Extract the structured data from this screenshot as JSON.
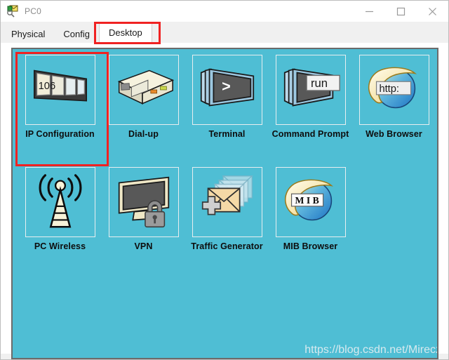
{
  "window": {
    "title": "PC0",
    "title_icon": "packet-tracer-device-icon",
    "buttons": {
      "minimize": "minimize-icon",
      "maximize": "maximize-icon",
      "close": "close-icon"
    }
  },
  "tabs": [
    {
      "label": "Physical",
      "selected": false
    },
    {
      "label": "Config",
      "selected": false
    },
    {
      "label": "Desktop",
      "selected": true
    }
  ],
  "annotations": {
    "tab_highlight_color": "#f02222",
    "item_highlight_color": "#f02222",
    "highlighted_tab": "Desktop",
    "highlighted_item": "IP Configuration"
  },
  "desktop": {
    "background_color": "#4fbed4",
    "items": [
      {
        "label": "IP Configuration",
        "icon": "ip-configuration-icon",
        "badge": "106",
        "highlighted": true
      },
      {
        "label": "Dial-up",
        "icon": "dial-up-modem-icon",
        "badge": "",
        "highlighted": false
      },
      {
        "label": "Terminal",
        "icon": "terminal-icon",
        "badge": ">",
        "highlighted": false
      },
      {
        "label": "Command Prompt",
        "icon": "command-prompt-icon",
        "badge": "run",
        "highlighted": false
      },
      {
        "label": "Web Browser",
        "icon": "web-browser-globe-icon",
        "badge": "http:",
        "highlighted": false
      },
      {
        "label": "PC Wireless",
        "icon": "wireless-tower-icon",
        "badge": "",
        "highlighted": false
      },
      {
        "label": "VPN",
        "icon": "vpn-monitor-lock-icon",
        "badge": "",
        "highlighted": false
      },
      {
        "label": "Traffic Generator",
        "icon": "traffic-generator-envelopes-icon",
        "badge": "",
        "highlighted": false
      },
      {
        "label": "MIB Browser",
        "icon": "mib-browser-globe-icon",
        "badge": "M I B",
        "highlighted": false
      }
    ]
  },
  "watermark": {
    "text": "https://blog.csdn.net/Mirecz"
  }
}
